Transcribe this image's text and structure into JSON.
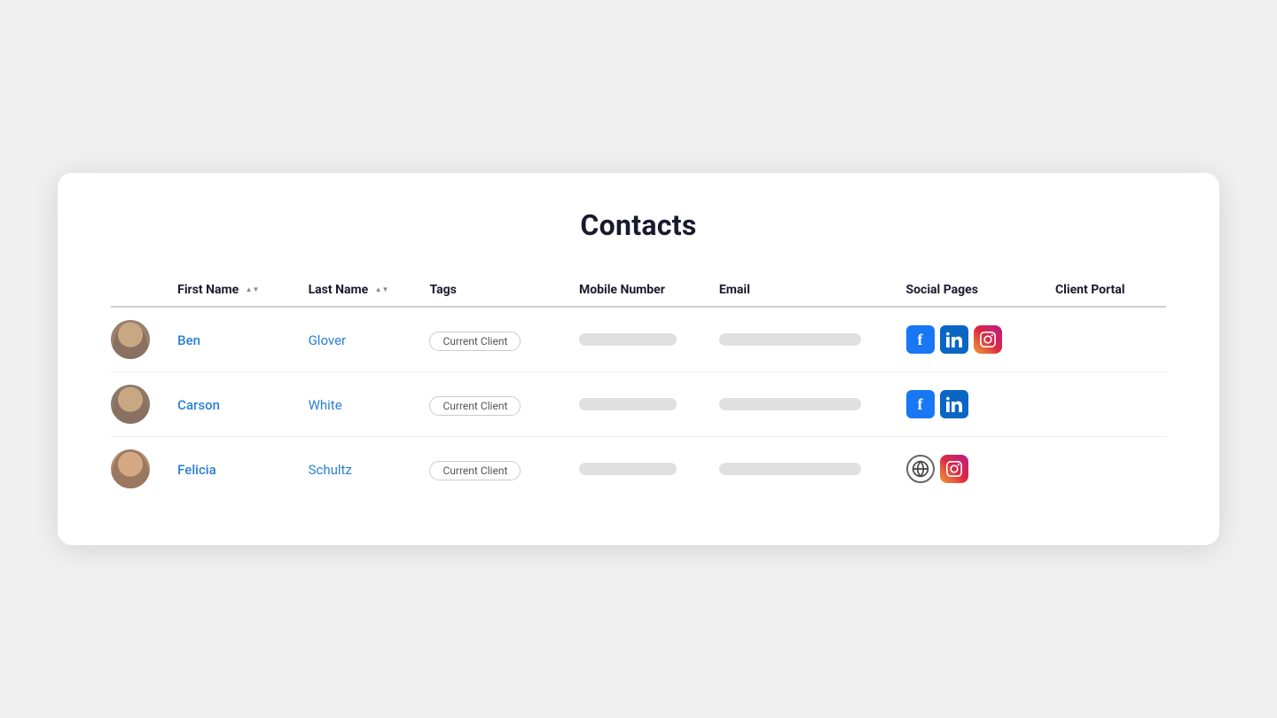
{
  "page": {
    "title": "Contacts"
  },
  "table": {
    "columns": [
      {
        "key": "avatar",
        "label": ""
      },
      {
        "key": "first_name",
        "label": "First Name",
        "sortable": true
      },
      {
        "key": "last_name",
        "label": "Last Name",
        "sortable": true
      },
      {
        "key": "tags",
        "label": "Tags",
        "sortable": false
      },
      {
        "key": "mobile",
        "label": "Mobile Number",
        "sortable": false
      },
      {
        "key": "email",
        "label": "Email",
        "sortable": false
      },
      {
        "key": "social",
        "label": "Social Pages",
        "sortable": false
      },
      {
        "key": "portal",
        "label": "Client Portal",
        "sortable": false
      }
    ],
    "rows": [
      {
        "id": 1,
        "avatar": "ben",
        "first_name": "Ben",
        "last_name": "Glover",
        "tag": "Current Client",
        "socials": [
          "facebook",
          "linkedin",
          "instagram"
        ]
      },
      {
        "id": 2,
        "avatar": "carson",
        "first_name": "Carson",
        "last_name": "White",
        "tag": "Current Client",
        "socials": [
          "facebook",
          "linkedin"
        ]
      },
      {
        "id": 3,
        "avatar": "felicia",
        "first_name": "Felicia",
        "last_name": "Schultz",
        "tag": "Current Client",
        "socials": [
          "web",
          "instagram"
        ]
      }
    ]
  },
  "labels": {
    "current_client": "Current Client",
    "first_name_header": "First Name",
    "last_name_header": "Last Name",
    "tags_header": "Tags",
    "mobile_header": "Mobile Number",
    "email_header": "Email",
    "social_header": "Social Pages",
    "portal_header": "Client Portal"
  }
}
